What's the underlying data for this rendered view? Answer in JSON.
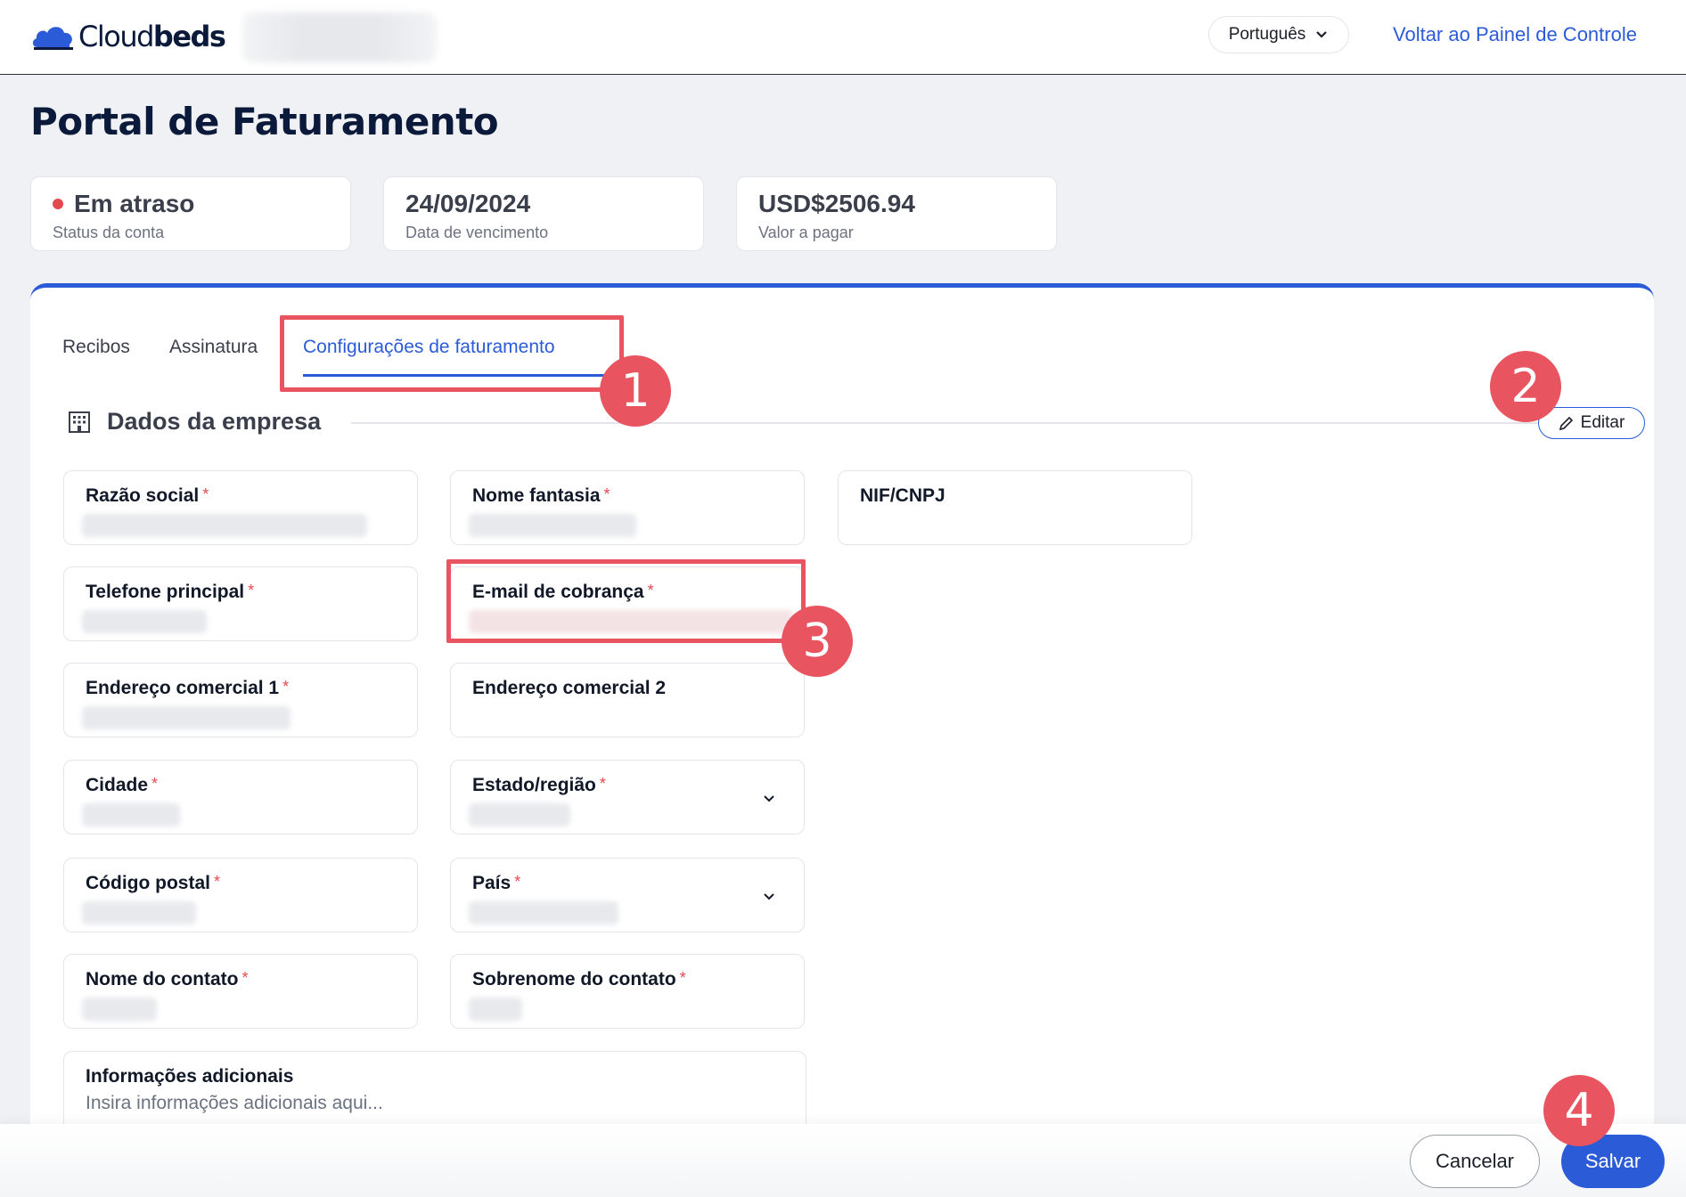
{
  "header": {
    "brand_regular": "Cloud",
    "brand_bold": "beds",
    "language": "Português",
    "back_link": "Voltar ao Painel de Controle"
  },
  "page_title": "Portal de Faturamento",
  "status_cards": [
    {
      "value": "Em atraso",
      "label": "Status da conta",
      "status_color": "#e5484d"
    },
    {
      "value": "24/09/2024",
      "label": "Data de vencimento"
    },
    {
      "value": "USD$2506.94",
      "label": "Valor a pagar"
    }
  ],
  "tabs": [
    {
      "label": "Recibos"
    },
    {
      "label": "Assinatura"
    },
    {
      "label": "Configurações de faturamento",
      "active": true
    }
  ],
  "section": {
    "title": "Dados da empresa",
    "edit_label": "Editar"
  },
  "fields": {
    "razao_social": "Razão social",
    "nome_fantasia": "Nome fantasia",
    "nif_cnpj": "NIF/CNPJ",
    "telefone": "Telefone principal",
    "email": "E-mail de cobrança",
    "endereco1": "Endereço comercial 1",
    "endereco2": "Endereço comercial 2",
    "cidade": "Cidade",
    "estado": "Estado/região",
    "codigo_postal": "Código postal",
    "pais": "País",
    "nome_contato": "Nome do contato",
    "sobrenome_contato": "Sobrenome do contato",
    "info_adicionais": "Informações adicionais",
    "info_placeholder": "Insira informações adicionais aqui...",
    "required_mark": "*"
  },
  "annotations": [
    "1",
    "2",
    "3",
    "4"
  ],
  "actions": {
    "cancel": "Cancelar",
    "save": "Salvar"
  },
  "colors": {
    "accent": "#2b5bd7",
    "annotation": "#e8545f",
    "required": "#e5484d"
  }
}
